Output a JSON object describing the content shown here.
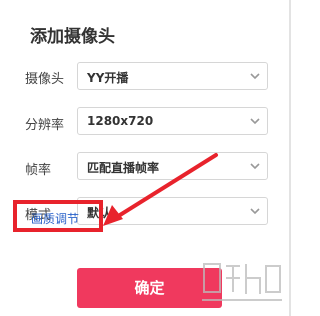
{
  "dialog": {
    "title": "添加摄像头",
    "rows": [
      {
        "label": "摄像头",
        "value": "YY开播"
      },
      {
        "label": "分辨率",
        "value": "1280x720"
      },
      {
        "label": "帧率",
        "value": "匹配直播帧率"
      },
      {
        "label": "模式",
        "value": "默认"
      }
    ],
    "quality_link": "画质调节",
    "confirm_label": "确定"
  },
  "colors": {
    "accent": "#f0395e",
    "link": "#2a62c9",
    "annotation": "#e8232c"
  },
  "icons": {
    "dropdown": "chevron-down-icon",
    "annotation_arrow": "arrow-annotation",
    "watermark": "watermark-logo"
  }
}
